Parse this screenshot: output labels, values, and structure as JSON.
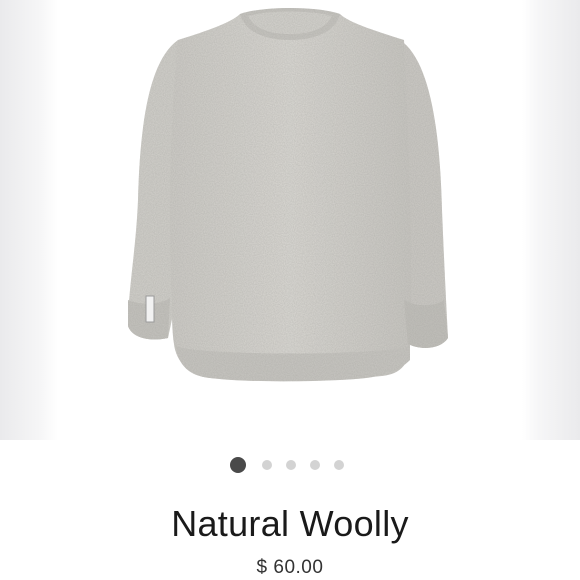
{
  "product": {
    "title": "Natural Woolly",
    "price": "$ 60.00",
    "image_description_icon": "sweater-image"
  },
  "carousel": {
    "total": 5,
    "active_index": 0
  },
  "colors": {
    "sweater": "#d9d7d2",
    "active_dot": "#4a4a4a",
    "inactive_dot": "#d3d3d3",
    "title_text": "#1a1a1a",
    "price_text": "#333333"
  }
}
